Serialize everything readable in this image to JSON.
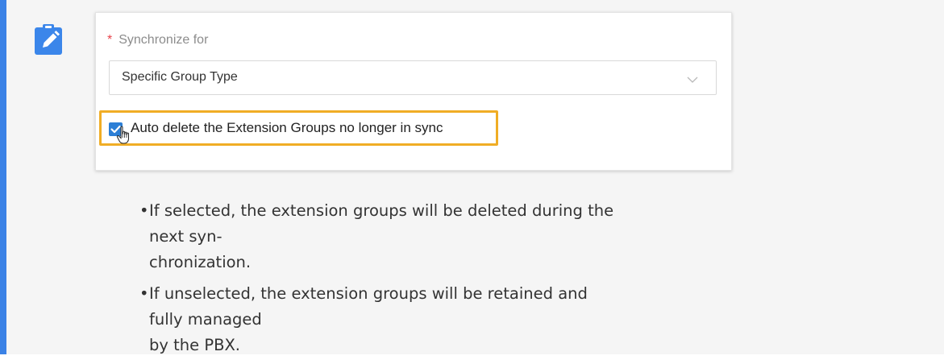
{
  "note": {
    "icon": "edit-note-icon",
    "accent_color": "#3b82e6"
  },
  "form": {
    "field_required_mark": "*",
    "field_label": "Synchronize for",
    "select_value": "Specific Group Type",
    "select_icon": "chevron-down-icon",
    "checkbox_checked": true,
    "checkbox_label": "Auto delete the Extension Groups no longer in sync",
    "highlight_color": "#f0ad25"
  },
  "bullets": [
    {
      "lines": [
        "If selected, the extension groups will be deleted during the next syn-",
        "chronization."
      ]
    },
    {
      "lines": [
        "If unselected, the extension groups will be retained and fully managed",
        "by the PBX."
      ]
    }
  ]
}
